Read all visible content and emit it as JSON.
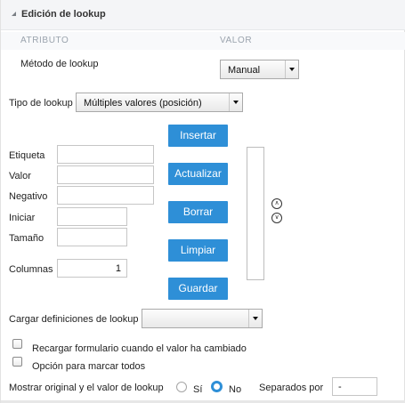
{
  "panel": {
    "title": "Edición de lookup"
  },
  "table_header": {
    "attribute": "ATRIBUTO",
    "value": "VALOR"
  },
  "lookup_method": {
    "label": "Método de lookup",
    "selected": "Manual"
  },
  "lookup_type": {
    "label": "Tipo de lookup",
    "selected": "Múltiples valores (posición)"
  },
  "fields": {
    "label_etiqueta": "Etiqueta",
    "label_valor": "Valor",
    "label_negativo": "Negativo",
    "label_iniciar": "Iniciar",
    "label_tamano": "Tamaño",
    "label_columnas": "Columnas",
    "columnas_value": "1"
  },
  "buttons": {
    "insert": "Insertar",
    "update": "Actualizar",
    "delete": "Borrar",
    "clear": "Limpiar",
    "save": "Guardar"
  },
  "icons": {
    "move_up": "circle-chevron-up-icon",
    "move_down": "circle-chevron-down-icon"
  },
  "load_definitions": {
    "label": "Cargar definiciones de lookup",
    "selected": ""
  },
  "reload_form": {
    "label": "Recargar formulario cuando el valor ha cambiado",
    "checked": false
  },
  "select_all": {
    "label": "Opción para marcar todos",
    "checked": false
  },
  "show_original": {
    "label": "Mostrar original y el valor de lookup",
    "option_yes": "Sí",
    "option_no": "No",
    "selected": "No"
  },
  "separator": {
    "label": "Separados por",
    "value": "-"
  },
  "colors": {
    "button": "#2e8fd7",
    "radio_selected": "#2e8fd7"
  }
}
